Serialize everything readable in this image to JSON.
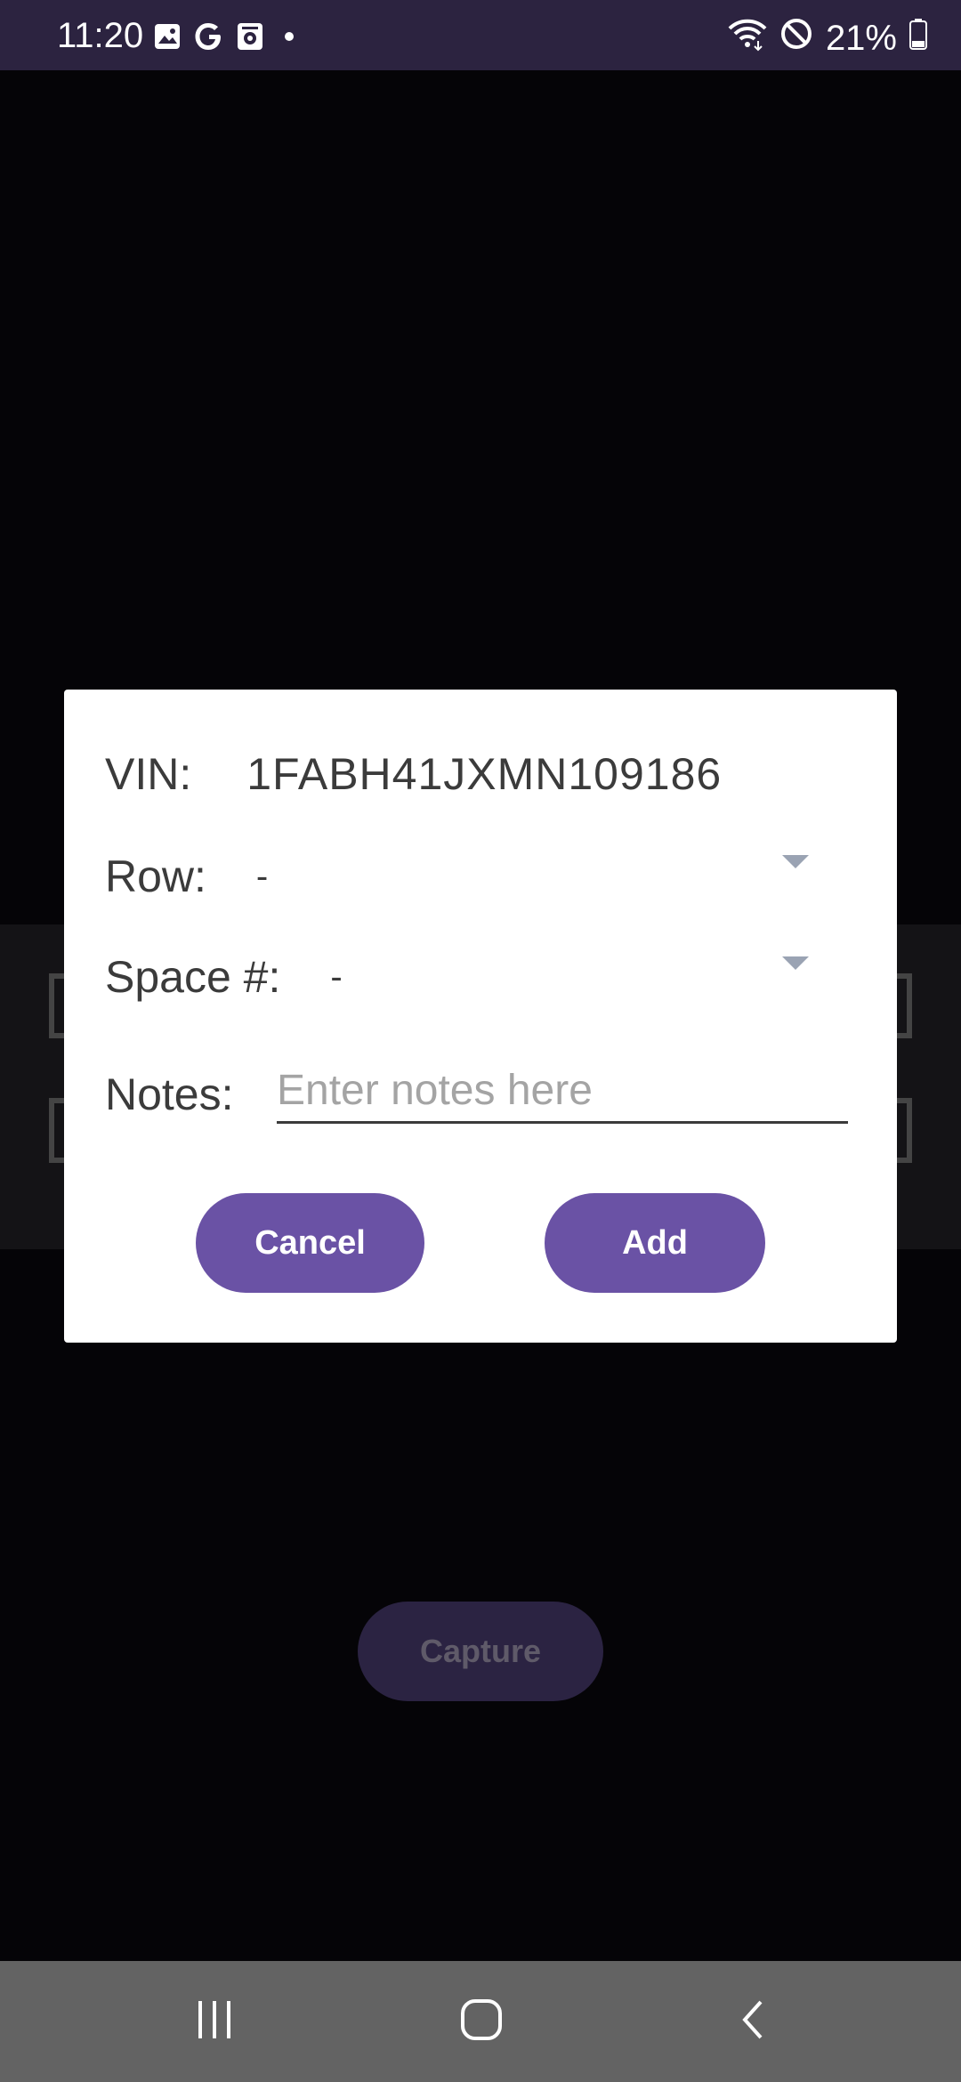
{
  "status_bar": {
    "time": "11:20",
    "left_icons": [
      "image-icon",
      "google-icon",
      "media-icon",
      "dot-icon"
    ],
    "battery_text": "21%",
    "right_icons": [
      "wifi-icon",
      "do-not-disturb-icon",
      "battery-icon"
    ]
  },
  "background": {
    "capture_label": "Capture"
  },
  "dialog": {
    "vin_label": "VIN:",
    "vin_value": "1FABH41JXMN109186",
    "row_label": "Row:",
    "row_value": "-",
    "space_label": "Space #:",
    "space_value": "-",
    "notes_label": "Notes:",
    "notes_placeholder": "Enter notes here",
    "notes_value": "",
    "cancel_label": "Cancel",
    "add_label": "Add"
  },
  "nav_bar": {
    "icons": [
      "recent-apps-icon",
      "home-icon",
      "back-icon"
    ]
  },
  "colors": {
    "status_bar": "#2c2340",
    "accent": "#6a52a5",
    "dialog_bg": "#ffffff",
    "nav_bar": "#636363"
  }
}
